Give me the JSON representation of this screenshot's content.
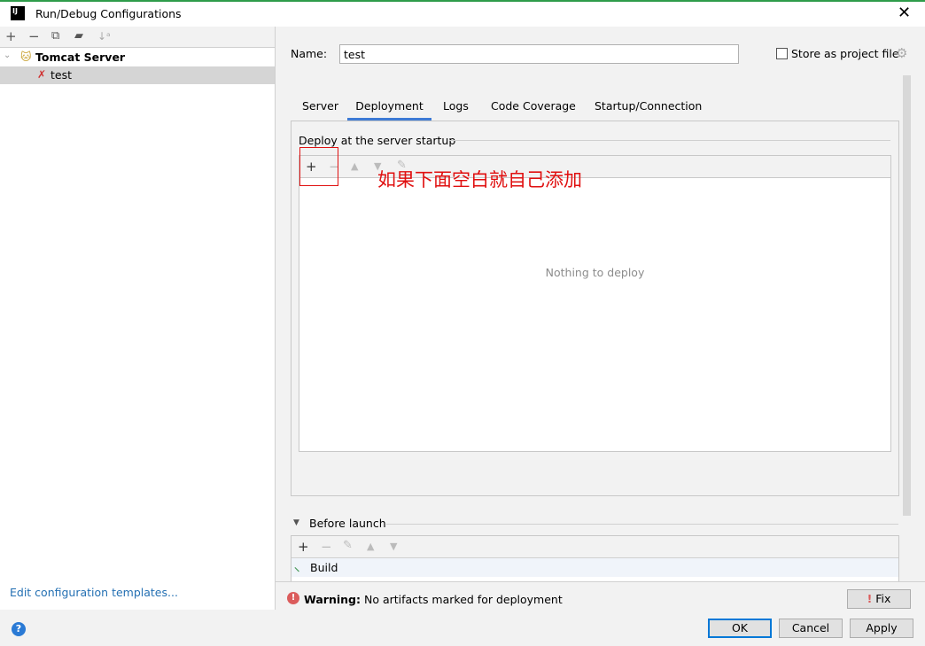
{
  "window": {
    "title": "Run/Debug Configurations",
    "app_icon": "IJ"
  },
  "left_panel": {
    "tree": [
      {
        "label": "Tomcat Server",
        "icon": "tomcat-icon",
        "expanded": true
      },
      {
        "label": "test",
        "icon": "tomcat-error-icon",
        "selected": true
      }
    ],
    "edit_templates": "Edit configuration templates..."
  },
  "form": {
    "name_label": "Name:",
    "name_value": "test",
    "store_label": "Store as project file",
    "store_checked": false
  },
  "tabs": [
    {
      "label": "Server"
    },
    {
      "label": "Deployment",
      "selected": true
    },
    {
      "label": "Logs"
    },
    {
      "label": "Code Coverage"
    },
    {
      "label": "Startup/Connection"
    }
  ],
  "deploy": {
    "section_title": "Deploy at the server startup",
    "empty_text": "Nothing to deploy",
    "annotation": "如果下面空白就自己添加"
  },
  "before_launch": {
    "title": "Before launch",
    "items": [
      {
        "label": "Build",
        "icon": "hammer-icon"
      }
    ]
  },
  "warning": {
    "bold": "Warning:",
    "text": "No artifacts marked for deployment",
    "fix_label": "Fix"
  },
  "buttons": {
    "ok": "OK",
    "cancel": "Cancel",
    "apply": "Apply"
  },
  "colors": {
    "accent": "#3d7ad5",
    "annotation": "#e01010",
    "link": "#2470b3",
    "error": "#db5c5c"
  }
}
